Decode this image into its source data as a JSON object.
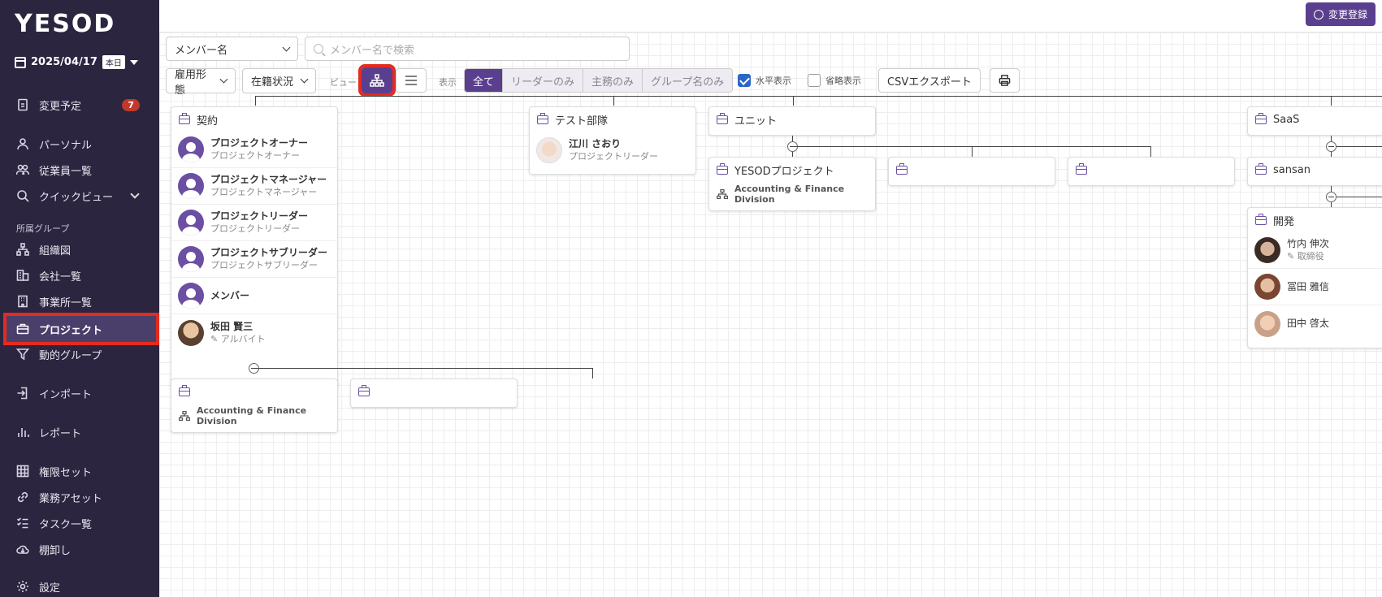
{
  "sidebar": {
    "logo": "YESOD",
    "date": "2025/04/17",
    "today": "本日",
    "items": [
      {
        "label": "変更予定",
        "badge": "7"
      },
      {
        "label": "パーソナル"
      },
      {
        "label": "従業員一覧"
      },
      {
        "label": "クイックビュー"
      },
      {
        "label": "組織図"
      },
      {
        "label": "会社一覧"
      },
      {
        "label": "事業所一覧"
      },
      {
        "label": "プロジェクト"
      },
      {
        "label": "動的グループ"
      },
      {
        "label": "インポート"
      },
      {
        "label": "レポート"
      },
      {
        "label": "権限セット"
      },
      {
        "label": "業務アセット"
      },
      {
        "label": "タスク一覧"
      },
      {
        "label": "棚卸し"
      },
      {
        "label": "設定"
      }
    ],
    "section_label": "所属グループ"
  },
  "header": {
    "register_label": "変更登録"
  },
  "filters": {
    "member_select": "メンバー名",
    "search_placeholder": "メンバー名で検索",
    "employment": "雇用形態",
    "status": "在籍状況",
    "view_label": "ビュー",
    "display_label": "表示",
    "display_options": [
      "全て",
      "リーダーのみ",
      "主務のみ",
      "グループ名のみ"
    ],
    "horizontal": "水平表示",
    "compact": "省略表示",
    "csv": "CSVエクスポート"
  },
  "colors": {
    "sidebar": "#2b2540",
    "accent": "#5b3f8f",
    "highlight": "#e52b1f"
  },
  "chart": {
    "keiyaku": {
      "title": "契約",
      "members": [
        {
          "name": "プロジェクトオーナー",
          "role": "プロジェクトオーナー"
        },
        {
          "name": "プロジェクトマネージャー",
          "role": "プロジェクトマネージャー"
        },
        {
          "name": "プロジェクトリーダー",
          "role": "プロジェクトリーダー"
        },
        {
          "name": "プロジェクトサブリーダー",
          "role": "プロジェクトサブリーダー"
        },
        {
          "name": "メンバー",
          "role": ""
        },
        {
          "name": "坂田 賢三",
          "role": "アルバイト"
        }
      ]
    },
    "test": {
      "title": "テスト部隊",
      "member": {
        "name": "江川 さおり",
        "role": "プロジェクトリーダー"
      }
    },
    "unit": {
      "title": "ユニット"
    },
    "yesod": {
      "title": "YESODプロジェクト",
      "division": "Accounting & Finance Division"
    },
    "saas": {
      "title": "SaaS"
    },
    "sansan": {
      "title": "sansan"
    },
    "dev": {
      "title": "開発",
      "members": [
        {
          "name": "竹内 伸次",
          "role": "取締役"
        },
        {
          "name": "冨田 雅信",
          "role": ""
        },
        {
          "name": "田中 啓太",
          "role": ""
        }
      ]
    },
    "sub_left": {
      "division": "Accounting & Finance Division"
    }
  }
}
